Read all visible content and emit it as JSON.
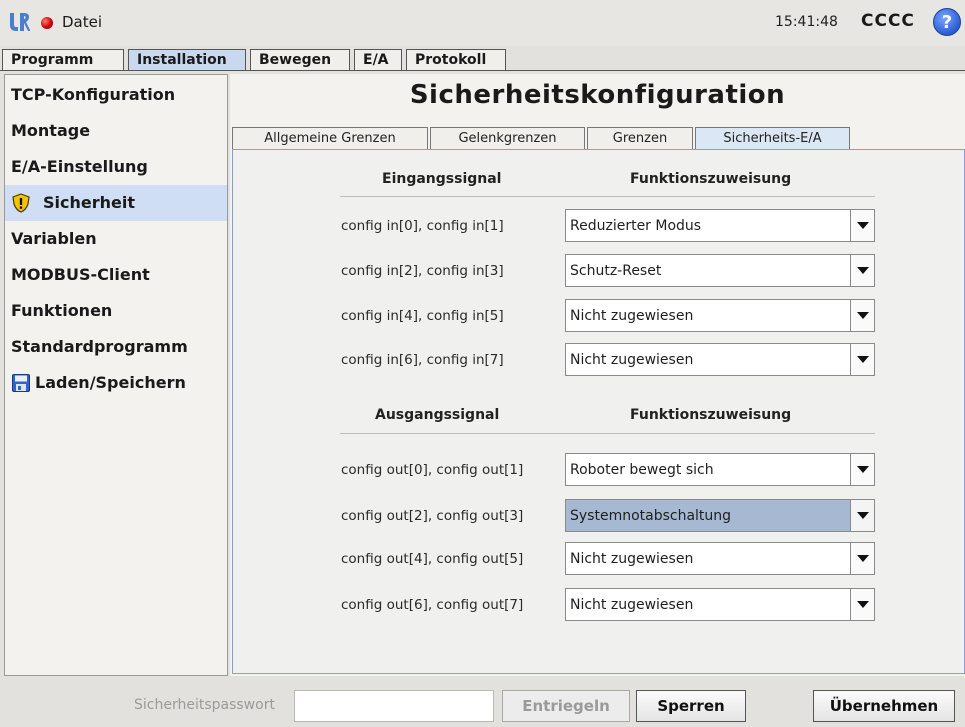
{
  "header": {
    "menu_label": "Datei",
    "clock": "15:41:48",
    "robot_name": "CCCC",
    "help_label": "?"
  },
  "main_tabs": [
    {
      "label": "Programm"
    },
    {
      "label": "Installation",
      "active": true
    },
    {
      "label": "Bewegen"
    },
    {
      "label": "E/A"
    },
    {
      "label": "Protokoll"
    }
  ],
  "sidebar": {
    "items": [
      {
        "label": "TCP-Konfiguration"
      },
      {
        "label": "Montage"
      },
      {
        "label": "E/A-Einstellung"
      },
      {
        "label": "Sicherheit",
        "icon": "warning-shield-icon",
        "selected": true
      },
      {
        "label": "Variablen"
      },
      {
        "label": "MODBUS-Client"
      },
      {
        "label": "Funktionen"
      },
      {
        "label": "Standardprogramm"
      },
      {
        "label": "Laden/Speichern",
        "icon": "floppy-disk-icon"
      }
    ]
  },
  "page_title": "Sicherheitskonfiguration",
  "sub_tabs": [
    {
      "label": "Allgemeine Grenzen"
    },
    {
      "label": "Gelenkgrenzen"
    },
    {
      "label": "Grenzen"
    },
    {
      "label": "Sicherheits-E/A",
      "active": true
    }
  ],
  "inputs": {
    "col_signal": "Eingangssignal",
    "col_function": "Funktionszuweisung",
    "rows": [
      {
        "signal": "config in[0], config in[1]",
        "function": "Reduzierter Modus"
      },
      {
        "signal": "config in[2], config in[3]",
        "function": "Schutz-Reset"
      },
      {
        "signal": "config in[4], config in[5]",
        "function": "Nicht zugewiesen"
      },
      {
        "signal": "config in[6], config in[7]",
        "function": "Nicht zugewiesen"
      }
    ]
  },
  "outputs": {
    "col_signal": "Ausgangssignal",
    "col_function": "Funktionszuweisung",
    "rows": [
      {
        "signal": "config out[0], config out[1]",
        "function": "Roboter bewegt sich"
      },
      {
        "signal": "config out[2], config out[3]",
        "function": "Systemnotabschaltung",
        "highlighted": true
      },
      {
        "signal": "config out[4], config out[5]",
        "function": "Nicht zugewiesen"
      },
      {
        "signal": "config out[6], config out[7]",
        "function": "Nicht zugewiesen"
      }
    ]
  },
  "footer": {
    "password_label": "Sicherheitspasswort",
    "password_value": "",
    "unlock_label": "Entriegeln",
    "lock_label": "Sperren",
    "apply_label": "Übernehmen"
  },
  "colors": {
    "selected_bg": "#cfdef5",
    "highlight_select": "#a7b9d2",
    "status_dot": "#d40000",
    "help_button": "#2f63d6"
  }
}
